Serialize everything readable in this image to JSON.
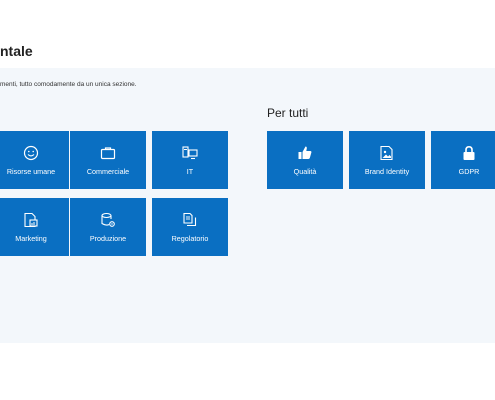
{
  "header": {
    "title": "ntale"
  },
  "intro": {
    "text": "menti, tutto comodamente da un unica sezione."
  },
  "left_group": {
    "tiles": [
      {
        "label": "Risorse umane",
        "icon": "smiley-icon"
      },
      {
        "label": "Commerciale",
        "icon": "briefcase-icon"
      },
      {
        "label": "IT",
        "icon": "computer-icon"
      },
      {
        "label": "Marketing",
        "icon": "document-chart-icon"
      },
      {
        "label": "Produzione",
        "icon": "database-gear-icon"
      },
      {
        "label": "Regolatorio",
        "icon": "documents-icon"
      }
    ]
  },
  "right_group": {
    "title": "Per tutti",
    "tiles": [
      {
        "label": "Qualità",
        "icon": "thumbs-up-icon"
      },
      {
        "label": "Brand Identity",
        "icon": "image-document-icon"
      },
      {
        "label": "GDPR",
        "icon": "lock-icon"
      }
    ]
  },
  "colors": {
    "tile": "#0a6fc2",
    "panel": "#f3f7fb",
    "text": "#1f1f1f"
  }
}
